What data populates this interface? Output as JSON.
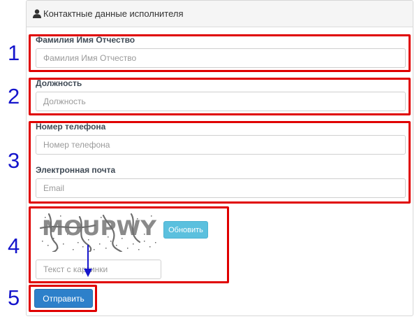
{
  "panel": {
    "title": "Контактные данные исполнителя",
    "icon": "user-icon"
  },
  "fields": {
    "fio": {
      "label": "Фамилия Имя Отчество",
      "placeholder": "Фамилия Имя Отчество",
      "value": ""
    },
    "position": {
      "label": "Должность",
      "placeholder": "Должность",
      "value": ""
    },
    "phone": {
      "label": "Номер телефона",
      "placeholder": "Номер телефона",
      "value": ""
    },
    "email": {
      "label": "Электронная почта",
      "placeholder": "Email",
      "value": ""
    },
    "captcha": {
      "placeholder": "Текст с картинки",
      "value": ""
    }
  },
  "captcha": {
    "text": "MOUPWY",
    "refresh_label": "Обновить"
  },
  "submit_label": "Отправить",
  "annotations": [
    "1",
    "2",
    "3",
    "4",
    "5"
  ],
  "colors": {
    "highlight": "#e00000",
    "annotation": "#1515cc",
    "refresh_button": "#5bc0de",
    "submit_button": "#2d80ca"
  }
}
